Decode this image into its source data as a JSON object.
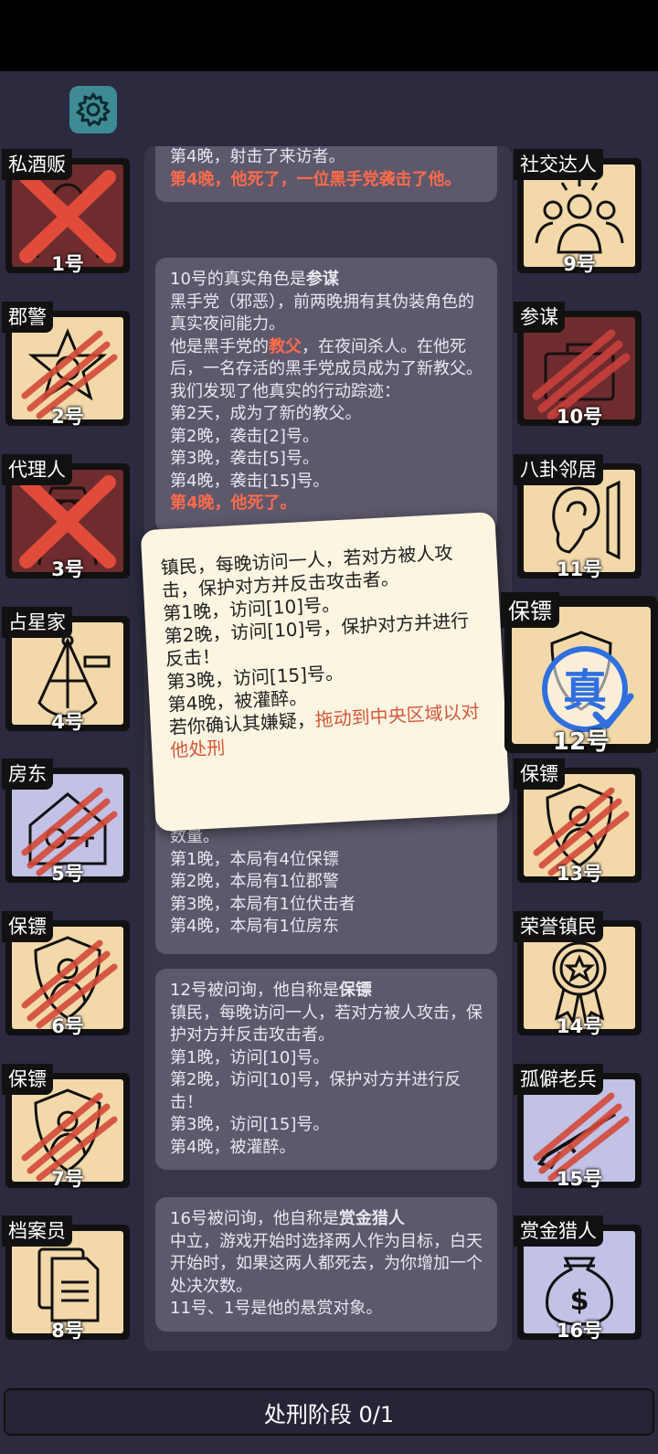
{
  "phase": "处刑阶段 0/1",
  "colors": {
    "accent_red": "#ff6b4a",
    "card_beige": "#f3d9a9",
    "card_red": "#6e2c2f",
    "card_lavender": "#c2c1e6",
    "settings": "#3f8b95"
  },
  "players_left": [
    {
      "name": "私酒贩",
      "num": "1号",
      "icon": "bootlegger-icon",
      "state": "dead"
    },
    {
      "name": "郡警",
      "num": "2号",
      "icon": "sheriff-star-icon",
      "state": "clawed"
    },
    {
      "name": "代理人",
      "num": "3号",
      "icon": "agent-icon",
      "state": "dead"
    },
    {
      "name": "占星家",
      "num": "4号",
      "icon": "sextant-icon",
      "state": "alive"
    },
    {
      "name": "房东",
      "num": "5号",
      "icon": "house-key-icon",
      "state": "clawed"
    },
    {
      "name": "保镖",
      "num": "6号",
      "icon": "shield-person-icon",
      "state": "clawed"
    },
    {
      "name": "保镖",
      "num": "7号",
      "icon": "shield-person-icon",
      "state": "clawed"
    },
    {
      "name": "档案员",
      "num": "8号",
      "icon": "documents-icon",
      "state": "alive"
    }
  ],
  "players_right": [
    {
      "name": "社交达人",
      "num": "9号",
      "icon": "crowd-icon",
      "state": "alive"
    },
    {
      "name": "参谋",
      "num": "10号",
      "icon": "briefcase-icon",
      "state": "clawed"
    },
    {
      "name": "八卦邻居",
      "num": "11号",
      "icon": "ear-icon",
      "state": "alive"
    },
    {
      "name": "保镖",
      "num": "12号",
      "icon": "true-stamp-icon",
      "state": "selected"
    },
    {
      "name": "保镖",
      "num": "13号",
      "icon": "shield-person-icon",
      "state": "clawed"
    },
    {
      "name": "荣誉镇民",
      "num": "14号",
      "icon": "medal-icon",
      "state": "alive"
    },
    {
      "name": "孤僻老兵",
      "num": "15号",
      "icon": "rifle-icon",
      "state": "clawed"
    },
    {
      "name": "赏金猎人",
      "num": "16号",
      "icon": "money-bag-icon",
      "state": "alive"
    }
  ],
  "log": {
    "e1": [
      "第4晚，射击了来访者。",
      "第4晚，他死了，一位黑手党袭击了他。"
    ],
    "e2": {
      "head": "10号的真实角色是",
      "role": "参谋",
      "l1": "黑手党（邪恶），前两晚拥有其伪装角色的真实夜间能力。",
      "l2a": "他是黑手党的",
      "l2b": "教父",
      "l2c": "，在夜间杀人。在他死后，一名存活的黑手党成员成为了新教父。",
      "l3": "我们发现了他真实的行动踪迹：",
      "l4": "第2天，成为了新的教父。",
      "l5": "第2晚，袭击[2]号。",
      "l6": "第3晚，袭击[5]号。",
      "l7": "第4晚，袭击[15]号。",
      "l8": "第4晚，他死了。"
    },
    "e3": [
      "数量。",
      "第1晚，本局有4位保镖",
      "第2晚，本局有1位郡警",
      "第3晚，本局有1位伏击者",
      "第4晚，本局有1位房东"
    ],
    "e4": {
      "head": "12号被问询，他自称是",
      "role": "保镖",
      "l1": "镇民，每晚访问一人，若对方被人攻击，保护对方并反击攻击者。",
      "l2": "第1晚，访问[10]号。",
      "l3": "第2晚，访问[10]号，保护对方并进行反击！",
      "l4": "第3晚，访问[15]号。",
      "l5": "第4晚，被灌醉。"
    },
    "e5": {
      "head": "16号被问询，他自称是",
      "role": "赏金猎人",
      "l1": "中立，游戏开始时选择两人作为目标，白天开始时，如果这两人都死去，为你增加一个处决次数。",
      "l2": "11号、1号是他的悬赏对象。"
    }
  },
  "tooltip": {
    "lines": [
      "镇民，每晚访问一人，若对方被人攻击，保护对方并反击攻击者。",
      "第1晚，访问[10]号。",
      "第2晚，访问[10]号，保护对方并进行反击！",
      "第3晚，访问[15]号。",
      "第4晚，被灌醉。"
    ],
    "hint_prefix": "若你确认其嫌疑，",
    "hint": "拖动到中央区域以对他处刑"
  },
  "stamp_text": "真"
}
